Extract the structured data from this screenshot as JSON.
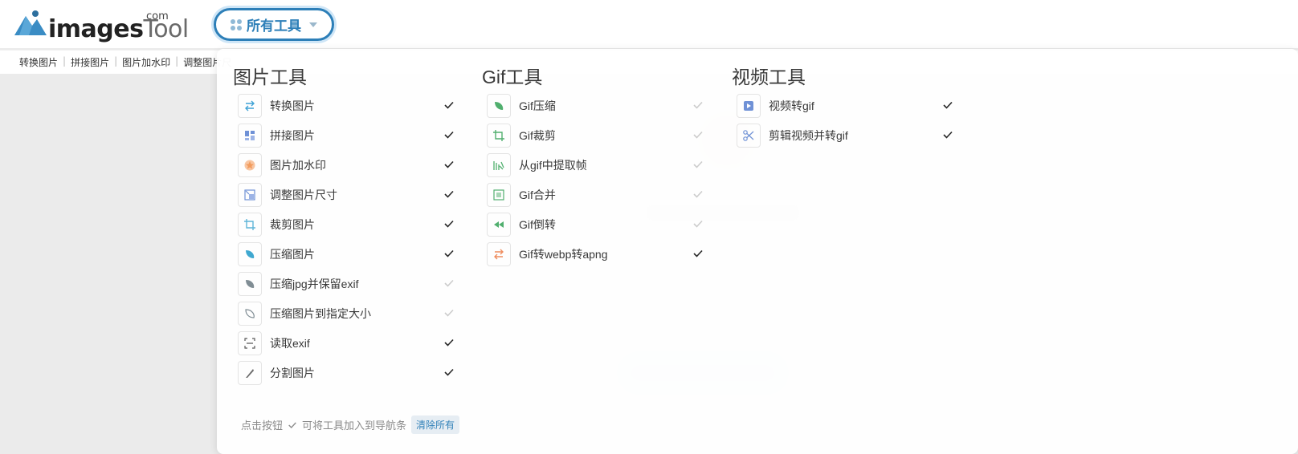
{
  "logo": {
    "text_images": "images",
    "text_tool": "Tool",
    "text_com": "com"
  },
  "header": {
    "all_tools_label": "所有工具"
  },
  "navbar": {
    "items": [
      "转换图片",
      "拼接图片",
      "图片加水印",
      "调整图片尺"
    ]
  },
  "columns": [
    {
      "title": "图片工具",
      "tools": [
        {
          "name": "转换图片",
          "icon": "convert-arrows-icon",
          "checked": true
        },
        {
          "name": "拼接图片",
          "icon": "collage-icon",
          "checked": true
        },
        {
          "name": "图片加水印",
          "icon": "star-badge-icon",
          "checked": true
        },
        {
          "name": "调整图片尺寸",
          "icon": "resize-icon",
          "checked": true
        },
        {
          "name": "裁剪图片",
          "icon": "crop-icon",
          "checked": true
        },
        {
          "name": "压缩图片",
          "icon": "leaf-icon",
          "checked": true
        },
        {
          "name": "压缩jpg并保留exif",
          "icon": "leaf-gray-icon",
          "checked": false
        },
        {
          "name": "压缩图片到指定大小",
          "icon": "leaf-outline-icon",
          "checked": false
        },
        {
          "name": "读取exif",
          "icon": "scan-icon",
          "checked": true
        },
        {
          "name": "分割图片",
          "icon": "knife-icon",
          "checked": true
        }
      ]
    },
    {
      "title": "Gif工具",
      "tools": [
        {
          "name": "Gif压缩",
          "icon": "leaf-green-icon",
          "checked": false
        },
        {
          "name": "Gif裁剪",
          "icon": "crop-green-icon",
          "checked": false
        },
        {
          "name": "从gif中提取帧",
          "icon": "frames-icon",
          "checked": false
        },
        {
          "name": "Gif合并",
          "icon": "film-icon",
          "checked": false
        },
        {
          "name": "Gif倒转",
          "icon": "rewind-icon",
          "checked": false
        },
        {
          "name": "Gif转webp转apng",
          "icon": "convert-orange-icon",
          "checked": true
        }
      ]
    },
    {
      "title": "视频工具",
      "tools": [
        {
          "name": "视频转gif",
          "icon": "play-icon",
          "checked": true
        },
        {
          "name": "剪辑视频并转gif",
          "icon": "scissors-icon",
          "checked": true
        }
      ]
    }
  ],
  "footer": {
    "hint_prefix": "点击按钮",
    "hint_suffix": "可将工具加入到导航条",
    "clear_label": "清除所有"
  },
  "colors": {
    "accent": "#2d7fb8",
    "check_on": "#222222",
    "check_off": "#cccccc"
  }
}
